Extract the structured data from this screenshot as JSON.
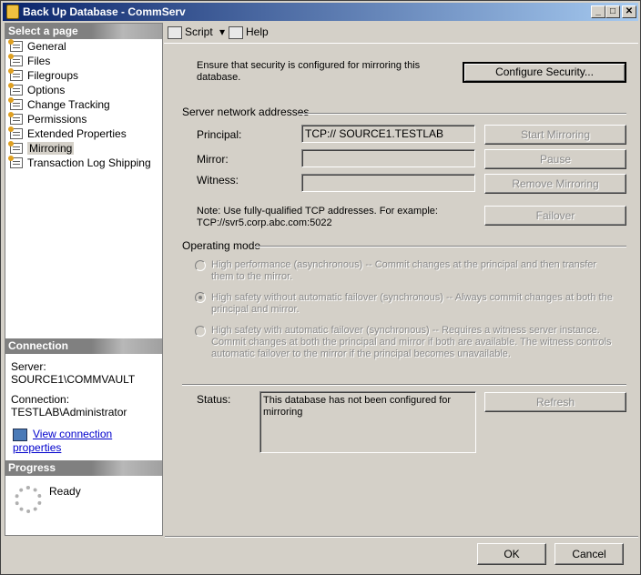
{
  "window": {
    "title": "Back Up Database - CommServ",
    "minimize": "_",
    "maximize": "□",
    "close": "✕"
  },
  "sidebar": {
    "select_page_header": "Select a page",
    "pages": [
      {
        "label": "General"
      },
      {
        "label": "Files"
      },
      {
        "label": "Filegroups"
      },
      {
        "label": "Options"
      },
      {
        "label": "Change Tracking"
      },
      {
        "label": "Permissions"
      },
      {
        "label": "Extended Properties"
      },
      {
        "label": "Mirroring"
      },
      {
        "label": "Transaction Log Shipping"
      }
    ],
    "selected_page": "Mirroring",
    "connection_header": "Connection",
    "server_label": "Server:",
    "server_value": "SOURCE1\\COMMVAULT",
    "connection_label": "Connection:",
    "connection_value": "TESTLAB\\Administrator",
    "view_connection_link": "View connection properties",
    "progress_header": "Progress",
    "progress_status": "Ready"
  },
  "toolbar": {
    "script_label": "Script",
    "script_dropdown": "▾",
    "help_label": "Help"
  },
  "main": {
    "security_note": "Ensure that security is configured for mirroring this database.",
    "configure_security_button": "Configure Security...",
    "server_network_header": "Server network addresses",
    "principal_label": "Principal:",
    "principal_value": "TCP:// SOURCE1.TESTLAB",
    "mirror_label": "Mirror:",
    "mirror_value": "",
    "witness_label": "Witness:",
    "witness_value": "",
    "start_mirroring_button": "Start Mirroring",
    "pause_button": "Pause",
    "remove_mirroring_button": "Remove Mirroring",
    "failover_button": "Failover",
    "tcp_note": "Note: Use fully-qualified TCP addresses. For example: TCP://svr5.corp.abc.com:5022",
    "operating_mode_header": "Operating mode",
    "modes": [
      {
        "text": "High performance (asynchronous) -- Commit changes at the principal and then transfer them to the mirror.",
        "checked": false
      },
      {
        "text": "High safety without automatic failover (synchronous) -- Always commit changes at both the principal and mirror.",
        "checked": true
      },
      {
        "text": "High safety with automatic failover (synchronous) -- Requires a witness server instance. Commit changes at both the principal and mirror if both are available. The witness controls automatic failover to the mirror if the principal becomes unavailable.",
        "checked": false
      }
    ],
    "status_label": "Status:",
    "status_value": "This database has not been configured for mirroring",
    "refresh_button": "Refresh"
  },
  "footer": {
    "ok_button": "OK",
    "cancel_button": "Cancel"
  }
}
